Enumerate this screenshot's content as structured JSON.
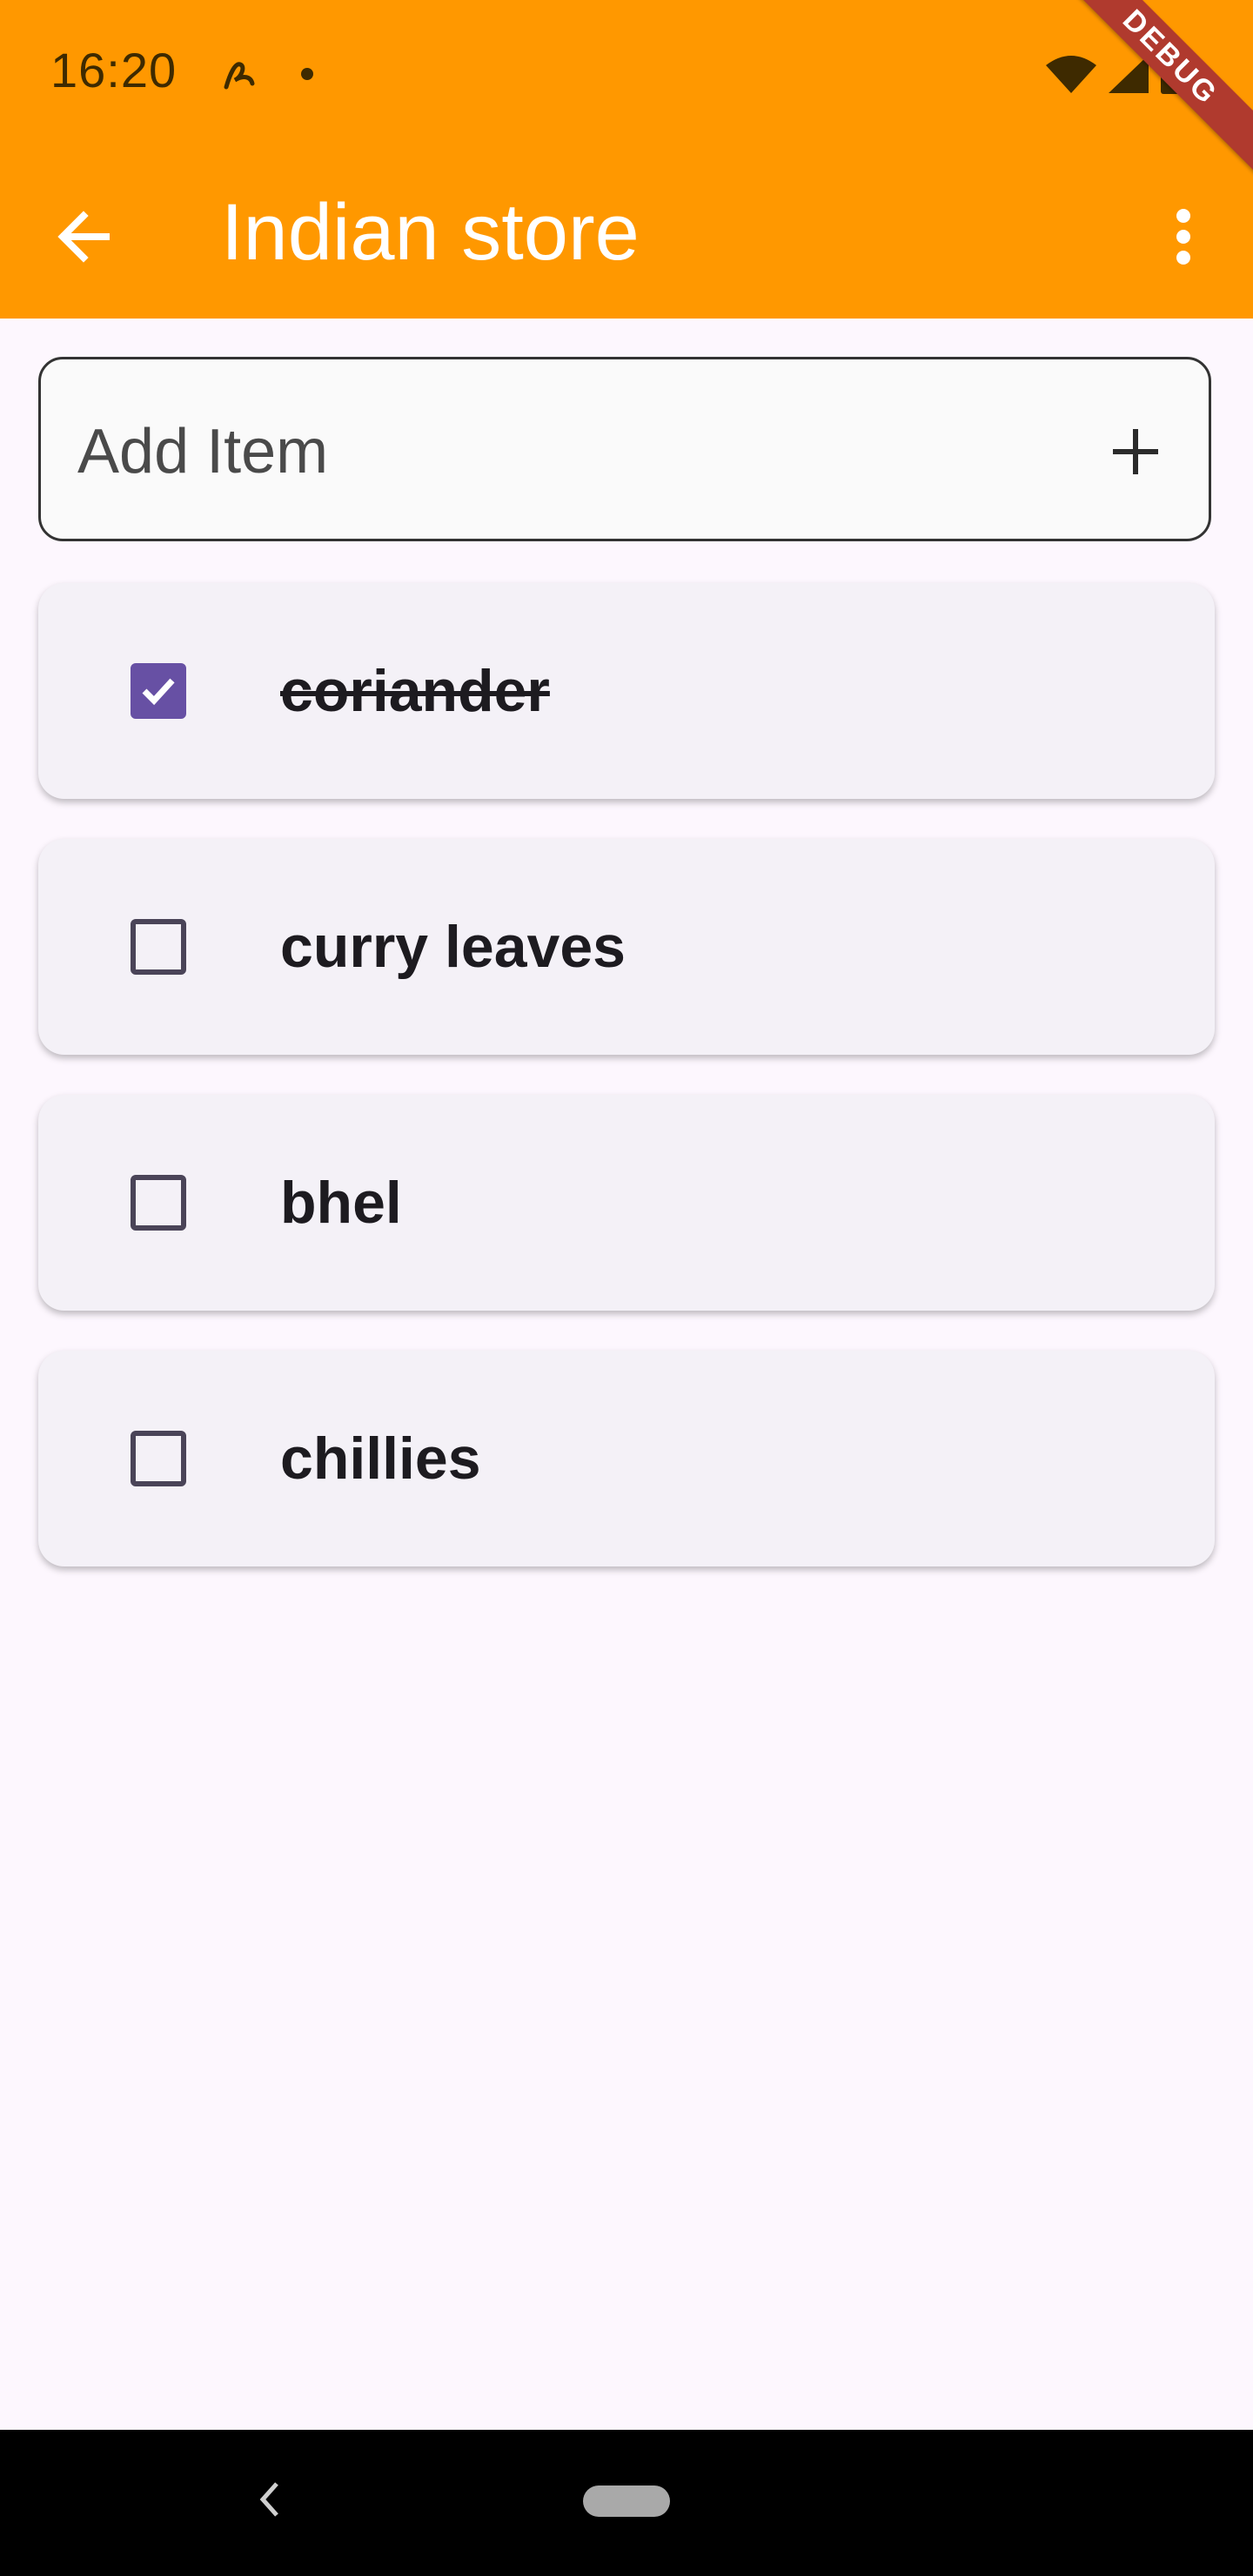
{
  "status_bar": {
    "time": "16:20",
    "icons": [
      "assistant-icon",
      "notification-dot",
      "wifi-icon",
      "signal-icon",
      "battery-icon"
    ]
  },
  "debug_banner": "DEBUG",
  "app_bar": {
    "title": "Indian store",
    "back_icon": "arrow-left-icon",
    "menu_icon": "more-vert-icon",
    "background": "#FF9800"
  },
  "add_item": {
    "placeholder": "Add Item",
    "value": "",
    "action_icon": "plus-icon"
  },
  "items": [
    {
      "label": "coriander",
      "checked": true
    },
    {
      "label": "curry leaves",
      "checked": false
    },
    {
      "label": "bhel",
      "checked": false
    },
    {
      "label": "chillies",
      "checked": false
    }
  ],
  "colors": {
    "accent": "#6750A4",
    "card": "#F4F1F7",
    "page": "#FDF7FE"
  }
}
